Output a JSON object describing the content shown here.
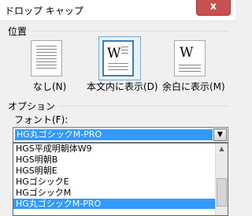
{
  "window": {
    "title": "ドロップ キャップ",
    "close_glyph": "x"
  },
  "position": {
    "heading": "位置",
    "options": [
      {
        "label": "なし(N)",
        "icon": "no-dropcap-icon"
      },
      {
        "label": "本文内に表示(D)",
        "icon": "dropped-icon",
        "selected": true
      },
      {
        "label": "余白に表示(M)",
        "icon": "in-margin-icon"
      }
    ]
  },
  "options": {
    "heading": "オプション",
    "font_label": "フォント(F):",
    "font_selected": "HG丸ゴシックM-PRO",
    "font_list": [
      "HGS平成明朝体W9",
      "HGS明朝B",
      "HGS明朝E",
      "HGゴシックE",
      "HGゴシックM",
      "HG丸ゴシックM-PRO"
    ],
    "font_list_selected_index": 5
  },
  "colors": {
    "selection": "#3399ff",
    "close_button": "#c75050",
    "selected_tile_border": "#3c7fb1"
  }
}
